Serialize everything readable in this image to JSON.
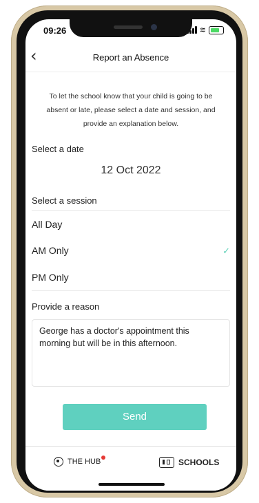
{
  "status": {
    "time": "09:26"
  },
  "nav": {
    "title": "Report an Absence"
  },
  "intro": {
    "text": "To let the school know that your child is going to be absent or late, please select a date and session, and provide an explanation below."
  },
  "date": {
    "label": "Select a date",
    "value": "12 Oct 2022"
  },
  "session": {
    "label": "Select a session",
    "options": [
      {
        "label": "All Day",
        "selected": false
      },
      {
        "label": "AM Only",
        "selected": true
      },
      {
        "label": "PM Only",
        "selected": false
      }
    ]
  },
  "reason": {
    "label": "Provide a reason",
    "value": "George has a doctor's appointment this morning but will be in this afternoon."
  },
  "actions": {
    "send_label": "Send"
  },
  "tabs": {
    "hub_label": "THE HUB",
    "schools_label": "SCHOOLS"
  },
  "colors": {
    "accent": "#5fd0bf",
    "notification": "#e53935",
    "frame": "#d8c8a6"
  },
  "icons": {
    "back": "chevron-left-icon",
    "check": "check-icon",
    "hub": "hub-icon",
    "schools": "school-icon"
  }
}
